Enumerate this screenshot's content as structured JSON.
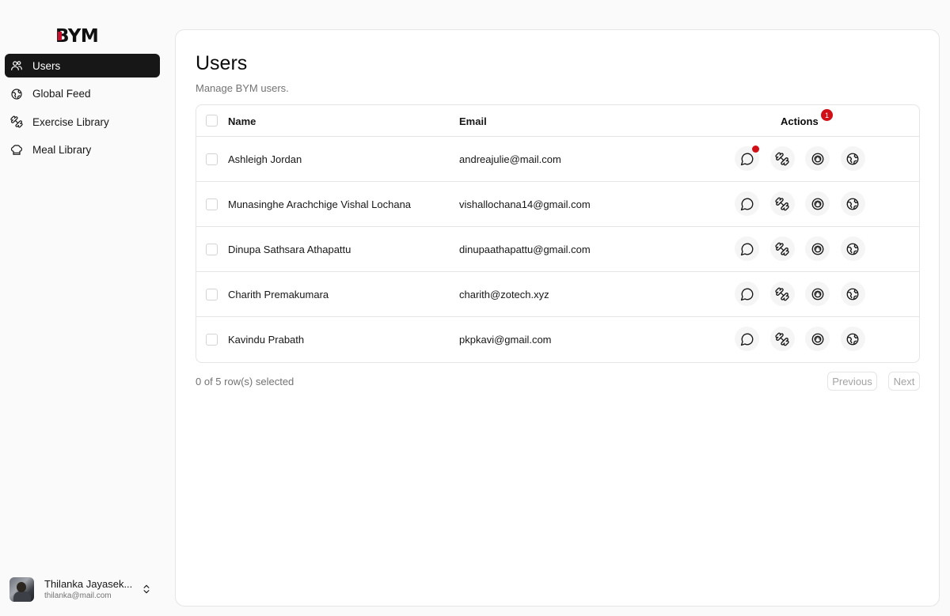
{
  "brand": {
    "logo_text": "BYM"
  },
  "sidebar": {
    "items": [
      {
        "label": "Users",
        "icon": "users-icon",
        "active": true
      },
      {
        "label": "Global Feed",
        "icon": "globe-icon",
        "active": false
      },
      {
        "label": "Exercise Library",
        "icon": "dumbbell-icon",
        "active": false
      },
      {
        "label": "Meal Library",
        "icon": "chef-hat-icon",
        "active": false
      }
    ],
    "user": {
      "name": "Thilanka Jayasek...",
      "email": "thilanka@mail.com"
    }
  },
  "main": {
    "title": "Users",
    "subtitle": "Manage BYM users.",
    "table": {
      "headers": {
        "name": "Name",
        "email": "Email",
        "actions": "Actions"
      },
      "actions_badge": "1",
      "rows": [
        {
          "name": "Ashleigh Jordan",
          "email": "andreajulie@mail.com",
          "unread": true
        },
        {
          "name": "Munasinghe Arachchige Vishal Lochana",
          "email": "vishallochana14@gmail.com",
          "unread": false
        },
        {
          "name": "Dinupa Sathsara Athapattu",
          "email": "dinupaathapattu@gmail.com",
          "unread": false
        },
        {
          "name": "Charith Premakumara",
          "email": "charith@zotech.xyz",
          "unread": false
        },
        {
          "name": "Kavindu Prabath",
          "email": "pkpkavi@gmail.com",
          "unread": false
        }
      ],
      "action_icons": [
        "message-icon",
        "dumbbell-icon",
        "meal-icon",
        "globe-icon"
      ]
    },
    "selection_text": "0 of 5 row(s) selected",
    "pagination": {
      "previous": "Previous",
      "next": "Next"
    }
  },
  "colors": {
    "accent": "#171717",
    "badge": "#d10f16",
    "muted": "#737373"
  }
}
